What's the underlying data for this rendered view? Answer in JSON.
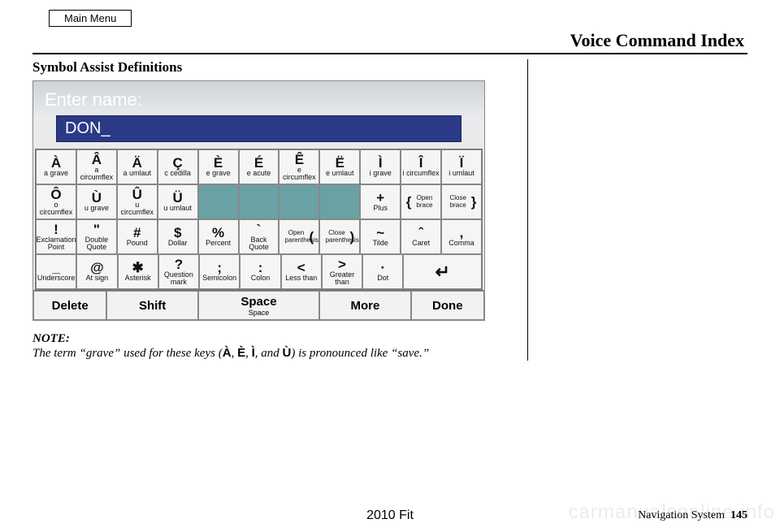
{
  "header": {
    "main_menu": "Main Menu",
    "title": "Voice Command Index"
  },
  "section_title": "Symbol Assist Definitions",
  "screen": {
    "prompt": "Enter name:",
    "input_value": "DON_",
    "rows": [
      [
        {
          "sym": "À",
          "label": "a grave"
        },
        {
          "sym": "Â",
          "label": "a circumflex"
        },
        {
          "sym": "Ä",
          "label": "a umlaut"
        },
        {
          "sym": "Ç",
          "label": "c cedilla"
        },
        {
          "sym": "È",
          "label": "e grave"
        },
        {
          "sym": "É",
          "label": "e acute"
        },
        {
          "sym": "Ê",
          "label": "e circumflex"
        },
        {
          "sym": "Ë",
          "label": "e umlaut"
        },
        {
          "sym": "Ì",
          "label": "i grave"
        },
        {
          "sym": "Î",
          "label": "i circumflex"
        },
        {
          "sym": "Ï",
          "label": "i umlaut"
        }
      ],
      [
        {
          "sym": "Ô",
          "label": "o circumflex"
        },
        {
          "sym": "Ù",
          "label": "u grave"
        },
        {
          "sym": "Û",
          "label": "u circumflex"
        },
        {
          "sym": "Ü",
          "label": "u umlaut"
        },
        {
          "inactive": true
        },
        {
          "inactive": true
        },
        {
          "inactive": true
        },
        {
          "inactive": true
        },
        {
          "sym": "+",
          "label": "Plus"
        },
        {
          "sym": "{",
          "label": "Open brace",
          "side": "left"
        },
        {
          "sym": "}",
          "label": "Close brace",
          "side": "right"
        }
      ],
      [
        {
          "sym": "!",
          "label": "Exclamation Point"
        },
        {
          "sym": "\"",
          "label": "Double Quote"
        },
        {
          "sym": "#",
          "label": "Pound"
        },
        {
          "sym": "$",
          "label": "Dollar"
        },
        {
          "sym": "%",
          "label": "Percent"
        },
        {
          "sym": "`",
          "label": "Back Quote"
        },
        {
          "sym": "(",
          "label": "Open parenthesis",
          "side": "right"
        },
        {
          "sym": ")",
          "label": "Close parenthesis",
          "side": "right"
        },
        {
          "sym": "~",
          "label": "Tilde"
        },
        {
          "sym": "ˆ",
          "label": "Caret"
        },
        {
          "sym": ",",
          "label": "Comma"
        }
      ],
      [
        {
          "sym": "_",
          "label": "Underscore"
        },
        {
          "sym": "@",
          "label": "At sign"
        },
        {
          "sym": "✱",
          "label": "Asterisk"
        },
        {
          "sym": "?",
          "label": "Question mark"
        },
        {
          "sym": ";",
          "label": "Semicolon"
        },
        {
          "sym": ":",
          "label": "Colon"
        },
        {
          "sym": "<",
          "label": "Less than"
        },
        {
          "sym": ">",
          "label": "Greater than"
        },
        {
          "sym": "·",
          "label": "Dot"
        },
        {
          "enter": true,
          "sym": "↵",
          "span": 2
        }
      ]
    ],
    "bottom": {
      "delete": "Delete",
      "shift": "Shift",
      "space": "Space",
      "space_sub": "Space",
      "more": "More",
      "done": "Done"
    }
  },
  "note": {
    "label": "NOTE:",
    "before": "The term “grave” used for these keys (",
    "syms": [
      "À",
      "È",
      "Ì",
      "Ù"
    ],
    "sep1": ", ",
    "sep2": ", ",
    "sep3": ", and ",
    "after": ") is pronounced like “save.”"
  },
  "footer": {
    "center": "2010 Fit",
    "label": "Navigation System",
    "page": "145"
  },
  "watermark": "carmanualsonline.info"
}
